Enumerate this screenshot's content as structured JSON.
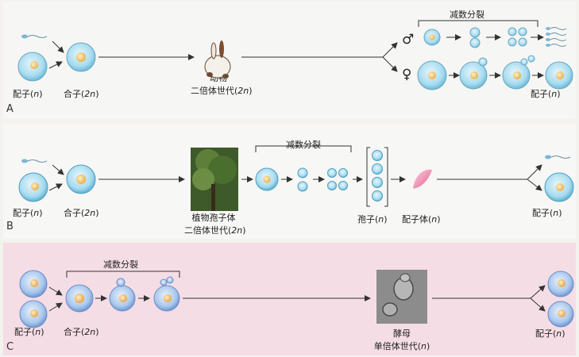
{
  "panel_a": {
    "letter": "A",
    "gamete_label": "配子(",
    "zygote_label": "合子(",
    "organism_line1": "动物",
    "organism_line2": "二倍体世代(",
    "meiosis_label": "减数分裂",
    "male_symbol": "♂",
    "female_symbol": "♀",
    "gamete_end_label": "配子("
  },
  "panel_b": {
    "letter": "B",
    "gamete_label": "配子(",
    "zygote_label": "合子(",
    "organism_line1": "植物孢子体",
    "organism_line2": "二倍体世代(",
    "meiosis_label": "减数分裂",
    "spore_label": "孢子(",
    "gametophyte_label": "配子体(",
    "gamete_end_label": "配子("
  },
  "panel_c": {
    "letter": "C",
    "meiosis_label": "减数分裂",
    "gamete_label": "配子(",
    "zygote_label": "合子(",
    "organism_line1": "酵母",
    "organism_line2": "单倍体世代(",
    "gamete_end_label": "配子("
  },
  "ploidy": {
    "haploid": "n",
    "diploid": "2n",
    "close": ")"
  },
  "colors": {
    "cell": "#a9dcef",
    "nucleus": "#f2c462",
    "arrow": "#333333",
    "panel_c_bg": "#f5dde6"
  },
  "icons": {
    "animal": "rabbit",
    "plant": "tree-photo",
    "yeast": "yeast-micrograph",
    "sperm": "sperm",
    "gametophyte": "pink-leaf"
  }
}
